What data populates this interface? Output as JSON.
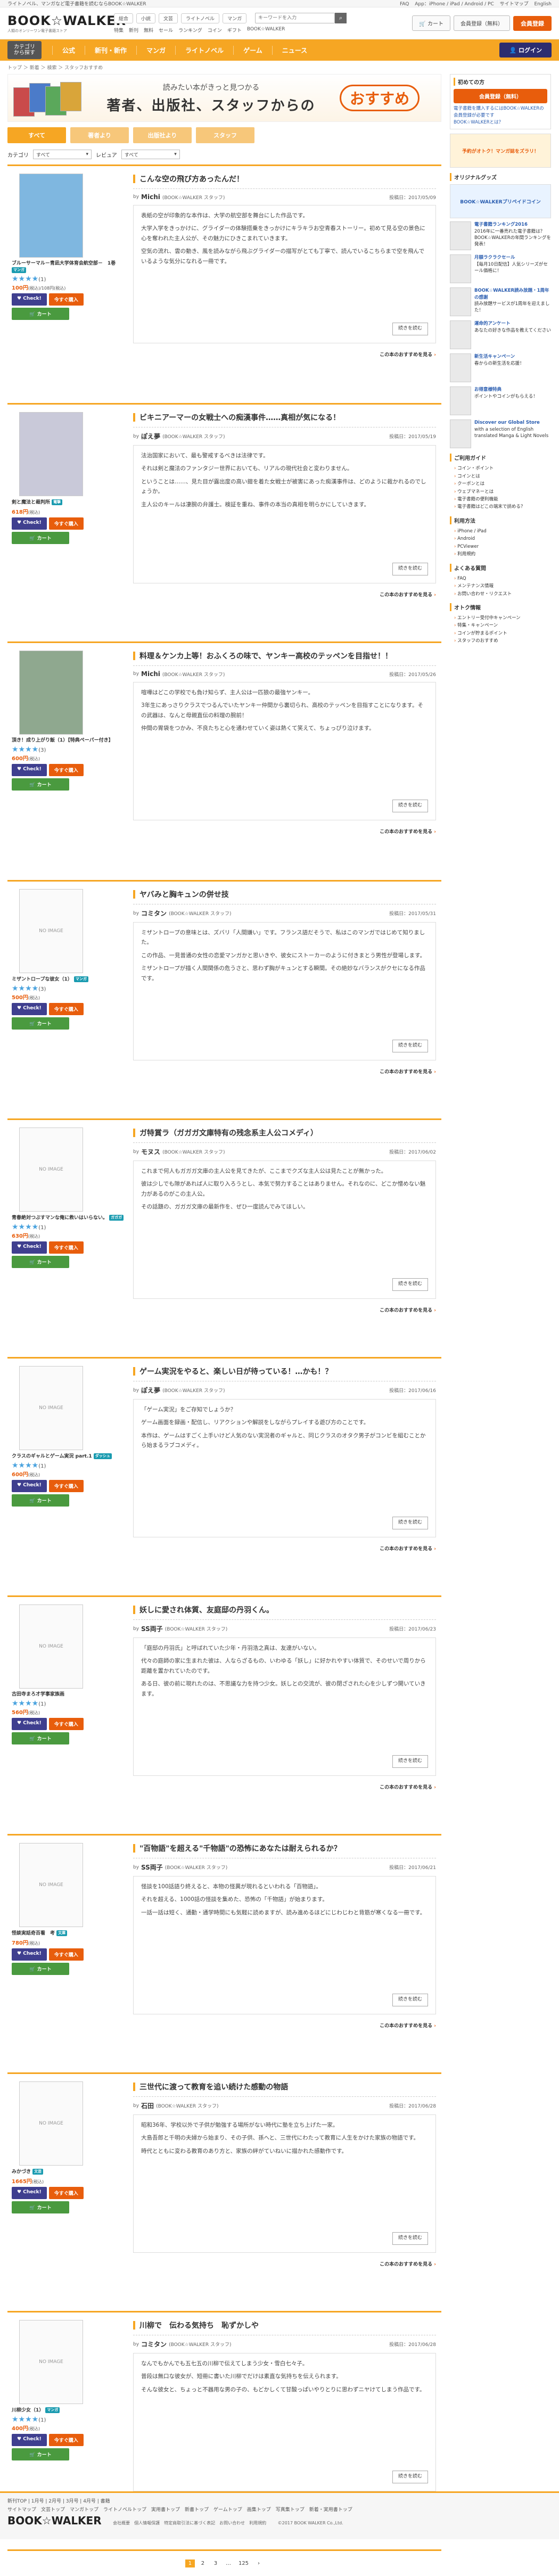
{
  "top_strip": {
    "left": "ライトノベル、マンガなど電子書籍を読むならBOOK☆WALKER",
    "links": [
      "FAQ",
      "App：iPhone / iPad / Android / PC",
      "サイトマップ",
      "English"
    ]
  },
  "header": {
    "logo": "BOOK☆WALKER",
    "logo_sub": "人類のオンリーワン電子書籍ストア",
    "mini_tabs": [
      "総合",
      "小説",
      "文芸",
      "ライトノベル",
      "マンガ"
    ],
    "search_placeholder": "キーワードを入力",
    "sub_links": [
      "特集",
      "新刊",
      "無料",
      "セール",
      "ランキング",
      "コイン",
      "ギフト",
      "BOOK☆WALKER"
    ],
    "cart_link": "カート",
    "register": "会員登録（無料）",
    "orange_btn": "会員登録"
  },
  "navbar": {
    "category_btn_line1": "カテゴリ",
    "category_btn_line2": "から探す",
    "items": [
      "公式",
      "新刊・新作",
      "マンガ",
      "ライトノベル",
      "ゲーム",
      "ニュース"
    ],
    "login": "ログイン"
  },
  "breadcrumb": "トップ ＞ 新着 ＞ 検索 ＞ スタッフおすすめ",
  "banner": {
    "sub": "読みたい本がきっと見つかる",
    "main": "著者、出版社、スタッフからの",
    "badge": "おすすめ"
  },
  "tabs": [
    {
      "label": "すべて",
      "active": true
    },
    {
      "label": "著者より",
      "active": false
    },
    {
      "label": "出版社より",
      "active": false
    },
    {
      "label": "スタッフ",
      "active": false
    }
  ],
  "filters": {
    "category_label": "カテゴリ",
    "category_value": "すべて",
    "review_label": "レビュア",
    "review_value": "すべて"
  },
  "posts": [
    {
      "title": "こんな空の飛び方あったんだ！",
      "author": "Michi",
      "role": "(BOOK☆WALKER スタッフ)",
      "date": "投稿日：2017/05/09",
      "body": [
        "表紙の空が印象的な本作は、大学の航空部を舞台にした作品です。",
        "大学入学をきっかけに、グライダーの体験搭乗をきっかけにキラキラお空青春ストーリー。初めて見る空の景色に心を奪われた主人公が、その魅力にひきこまれていきます。",
        "空気の流れ、雲の動き、風を読みながら飛ぶグライダーの描写がとても丁寧で、読んでいるこちらまで空を飛んでいるような気分になれる一冊です。"
      ],
      "book_title": "ブルーサーマル－青凪大学体育会航空部－　1巻",
      "badge": "マンガ",
      "stars": "★★★★",
      "rating": "(1)",
      "price": "100円",
      "price_note": "(税込)/108円(税込)"
    },
    {
      "title": "ビキニアーマーの女戦士への痴漢事件……真相が気になる！",
      "author": "ぽえ夢",
      "role": "(BOOK☆WALKER スタッフ)",
      "date": "投稿日：2017/05/19",
      "body": [
        "法治国家において、最も警戒するべきは法律です。",
        "それは剣と魔法のファンタジー世界においても、リアルの現代社会と変わりません。",
        "ということは……、見た目が露出度の高い鎧を着た女戦士が被害にあった痴漢事件は、どのように裁かれるのでしょうか。",
        "主人公のキールは凄腕の弁護士。検証を重ね、事件の本当の真相を明らかにしていきます。"
      ],
      "book_title": "剣と魔法と裁判所",
      "badge": "電撃",
      "stars": "",
      "rating": "",
      "price": "618円",
      "price_note": "(税込)",
      "cover_label": ""
    },
    {
      "title": "料理＆ケンカ上等！おふくろの味で、ヤンキー高校のテッペンを目指せ！！",
      "author": "Michi",
      "role": "(BOOK☆WALKER スタッフ)",
      "date": "投稿日：2017/05/26",
      "body": [
        "喧嘩はどこの学校でも負け知らず、主人公は一匹狼の最強ヤンキー。",
        "3年生にあっさりクラスでつるんでいたヤンキー仲間から裏切られ、高校のテッペンを目指すことになります。その武器は、なんと母親直伝の料理の腕前！",
        "仲間の胃袋をつかみ、不良たちと心を通わせていく姿は熱くて笑えて、ちょっぴり泣けます。"
      ],
      "book_title": "頂き！成り上がり飯（1）【特典ペーパー付き】",
      "badge": "",
      "stars": "★★★★",
      "rating": "(3)",
      "price": "600円",
      "price_note": "(税込)"
    },
    {
      "title": "ヤバみと胸キュンの併せ技",
      "author": "コミタン",
      "role": "(BOOK☆WALKER スタッフ)",
      "date": "投稿日：2017/05/31",
      "body": [
        "ミザントロープの意味とは、ズバリ「人間嫌い」です。フランス語だそうで、私はこのマンガではじめて知りました。",
        "この作品、一見普通の女性の恋愛マンガかと思いきや、彼女にストーカーのように付きまとう男性が登場します。",
        "ミザントロープが描く人間関係の危うさと、思わず胸がキュンとする瞬間。その絶妙なバランスがクセになる作品です。"
      ],
      "book_title": "ミザントロープな彼女（1）",
      "badge": "マンガ",
      "stars": "★★★★",
      "rating": "(3)",
      "price": "500円",
      "price_note": "(税込)"
    },
    {
      "title": "ガ特賞ラ（ガガガ文庫特有の残念系主人公コメディ）",
      "author": "モヌス",
      "role": "(BOOK☆WALKER スタッフ)",
      "date": "投稿日：2017/06/02",
      "body": [
        "これまで何人もガガガ文庫の主人公を見てきたが、ここまでクズな主人公は見たことが無かった。",
        "彼は少しでも隙があれば人に取り入ろうとし、本気で努力することはありません。それなのに、どこか憎めない魅力があるのがこの主人公。",
        "その話題の、ガガガ文庫の最新作を、ぜひ一度読んでみてほしい。"
      ],
      "book_title": "青春絶対つぶすマンな俺に救いはいらない。",
      "badge": "ガガガ",
      "stars": "★★★★",
      "rating": "(1)",
      "price": "630円",
      "price_note": "(税込)"
    },
    {
      "title": "ゲーム実況をやると、楽しい日が待っている！…かも！？",
      "author": "ぽえ夢",
      "role": "(BOOK☆WALKER スタッフ)",
      "date": "投稿日：2017/06/16",
      "body": [
        "「ゲーム実況」をご存知でしょうか？",
        "ゲーム画面を録画・配信し、リアクションや解説をしながらプレイする遊び方のことです。",
        "本作は、ゲームはすごく上手いけど人気のない実況者のギャルと、同じクラスのオタク男子がコンビを組むことから始まるラブコメディ。"
      ],
      "book_title": "クラスのギャルとゲーム実況 part.1",
      "badge": "ダッシュ",
      "stars": "★★★★",
      "rating": "(1)",
      "price": "600円",
      "price_note": "(税込)"
    },
    {
      "title": "妖しに愛され体質、友庭邸の丹羽くん。",
      "author": "SS両子",
      "role": "(BOOK☆WALKER スタッフ)",
      "date": "投稿日：2017/06/23",
      "body": [
        "「庭邸の丹羽氏」と呼ばれていた少年・丹羽浩之真は、友達がいない。",
        "代々の庭師の家に生まれた彼は、人ならざるもの、いわゆる「妖し」に好かれやすい体質で、そのせいで周りから距離を置かれていたのです。",
        "ある日、彼の前に現れたのは、不思議な力を持つ少女。妖しとの交流が、彼の閉ざされた心を少しずつ開いていきます。"
      ],
      "book_title": "古田寺まろ才学事家族画",
      "badge": "",
      "stars": "★★★★",
      "rating": "(1)",
      "price": "560円",
      "price_note": "(税込)"
    },
    {
      "title": "\"百物語\"を超える\"千物語\"の恐怖にあなたは耐えられるか？",
      "author": "SS両子",
      "role": "(BOOK☆WALKER スタッフ)",
      "date": "投稿日：2017/06/21",
      "body": [
        "怪談を100話語り終えると、本物の怪異が現れるといわれる「百物語」。",
        "それを超える、1000話の怪談を集めた、恐怖の「千物語」が始まります。",
        "一話一話は短く、通勤・通学時間にも気軽に読めますが、読み進めるほどにじわじわと背筋が寒くなる一冊です。"
      ],
      "book_title": "怪談実話奇百看　考",
      "badge": "文庫",
      "stars": "",
      "rating": "",
      "price": "780円",
      "price_note": "(税込)"
    },
    {
      "title": "三世代に渡って教育を追い続けた感動の物語",
      "author": "石田",
      "role": "(BOOK☆WALKER スタッフ)",
      "date": "投稿日：2017/06/28",
      "body": [
        "昭和36年、学校以外で子供が勉強する場所がない時代に塾を立ち上げた一家。",
        "大島吾郎と千明の夫婦から始まり、その子供、孫へと、三世代にわたって教育に人生をかけた家族の物語です。",
        "時代とともに変わる教育のあり方と、家族の絆がていねいに描かれた感動作です。"
      ],
      "book_title": "みかづき",
      "badge": "文芸",
      "stars": "",
      "rating": "",
      "price": "1665円",
      "price_note": "(税込)"
    },
    {
      "title": "川柳で　伝わる気持ち　恥ずかしや",
      "author": "コミタン",
      "role": "(BOOK☆WALKER スタッフ)",
      "date": "投稿日：2017/06/28",
      "body": [
        "なんでもかんでも五七五の川柳で伝えてしまう少女・雪白七々子。",
        "普段は無口な彼女が、短冊に書いた川柳でだけは素直な気持ちを伝えられます。",
        "そんな彼女と、ちょっと不器用な男の子の、もどかしくて甘酸っぱいやりとりに思わずニヤけてしまう作品です。"
      ],
      "book_title": "川柳少女（1）",
      "badge": "マンガ",
      "stars": "★★★★",
      "rating": "(1)",
      "price": "400円",
      "price_note": "(税込)"
    }
  ],
  "post_common": {
    "readmore": "続きを読む",
    "check": "Check!",
    "buy": "今すぐ購入",
    "cart": "カート",
    "footer_link": "この本のおすすめを見る",
    "no_image": "NO IMAGE"
  },
  "pager": [
    "1",
    "2",
    "3",
    "…",
    "125",
    "›"
  ],
  "sidebar": {
    "register_title": "初めての方",
    "register_btn": "会員登録（無料）",
    "register_note": "電子書籍を購入するにはBOOK☆WALKERの会員登録が必要です",
    "links1": [
      "BOOK☆WALKERとは？"
    ],
    "promo1": "予約がオトク！マンガ誌をズラリ！",
    "coin_box": "オリジナルグッズ",
    "prepaid": "BOOK☆WALKERプリペイドコイン",
    "entries": [
      {
        "t": "電子書籍ランキング2016",
        "d": "2016年に一番売れた電子書籍は？BOOK☆WALKERの年間ランキングを発表！"
      },
      {
        "t": "月額ラクラクセール",
        "d": "【毎月10日配信】人気シリーズがセール価格に！"
      },
      {
        "t": "BOOK☆WALKER読み放題・1周年の感謝",
        "d": "読み放題サービスが1周年を迎えました！"
      },
      {
        "t": "運命的アンケート",
        "d": "あなたの好きな作品を教えてください"
      },
      {
        "t": "新生活キャンペーン",
        "d": "春からの新生活を応援！"
      },
      {
        "t": "お得意様特典",
        "d": "ポイントやコインがもらえる！"
      },
      {
        "t": "Discover our Global Store",
        "d": "with a selection of English translated Manga & Light Novels"
      }
    ],
    "guide_title": "ご利用ガイド",
    "guide_links": [
      "コイン・ポイント",
      "コインとは",
      "クーポンとは",
      "ウェブマネーとは",
      "電子書籍の便利機能",
      "電子書籍はどこの端末で読める？"
    ],
    "apps_title": "利用方法",
    "apps": [
      "iPhone / iPad",
      "Android",
      "PCViewer",
      "利用規約"
    ],
    "faq_title": "よくある質問",
    "faq": [
      "FAQ",
      "メンテナンス情報",
      "お問い合わせ・リクエスト"
    ],
    "misc_title": "オトク情報",
    "misc": [
      "エントリー受付中キャンペーン",
      "特集・キャンペーン",
      "コインが貯まるポイント",
      "スタッフのおすすめ"
    ]
  },
  "footer": {
    "line1": "新刊TOP | 1月号 | 2月号 | 3月号 | 4月号 | 書籍",
    "line2": "サイトマップ　文芸トップ　マンガトップ　ライトノベルトップ　実用書トップ　新書トップ　ゲームトップ　画集トップ　写真集トップ　新着・実用書トップ",
    "logo": "BOOK☆WALKER",
    "links": "会社概要　個人情報保護　特定商取引法に基づく表記　お問い合わせ　利用規約",
    "copy": "©2017 BOOK WALKER Co.,Ltd."
  }
}
